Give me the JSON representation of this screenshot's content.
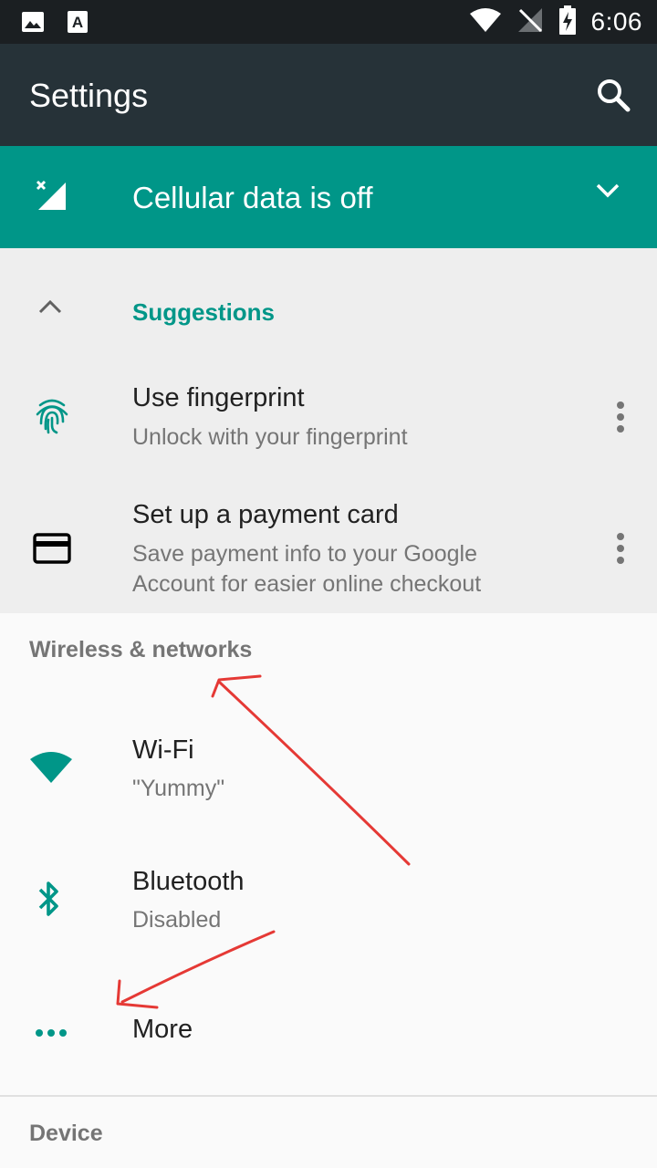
{
  "status_bar": {
    "time": "6:06",
    "left_icons": [
      "image-icon",
      "text-a-icon"
    ],
    "right_icons": [
      "wifi-icon",
      "no-signal-icon",
      "battery-charging-icon"
    ]
  },
  "toolbar": {
    "title": "Settings",
    "search_icon": "search-icon"
  },
  "condition_banner": {
    "text": "Cellular data is off",
    "icon": "cellular-off-icon",
    "expand_icon": "chevron-down-icon"
  },
  "suggestions": {
    "header": "Suggestions",
    "items": [
      {
        "title": "Use fingerprint",
        "subtitle": "Unlock with your fingerprint",
        "icon": "fingerprint-icon"
      },
      {
        "title": "Set up a payment card",
        "subtitle_line1": "Save payment info to your Google",
        "subtitle_line2": "Account for easier online checkout",
        "icon": "credit-card-icon"
      }
    ]
  },
  "wireless": {
    "header": "Wireless & networks",
    "items": [
      {
        "title": "Wi-Fi",
        "subtitle": "\"Yummy\"",
        "icon": "wifi-icon"
      },
      {
        "title": "Bluetooth",
        "subtitle": "Disabled",
        "icon": "bluetooth-icon"
      },
      {
        "title": "More",
        "icon": "more-horizontal-icon"
      }
    ]
  },
  "device": {
    "header": "Device"
  },
  "colors": {
    "accent": "#009688",
    "toolbar": "#263238",
    "status_bar": "#1b1f22",
    "annotation": "#e53935"
  }
}
